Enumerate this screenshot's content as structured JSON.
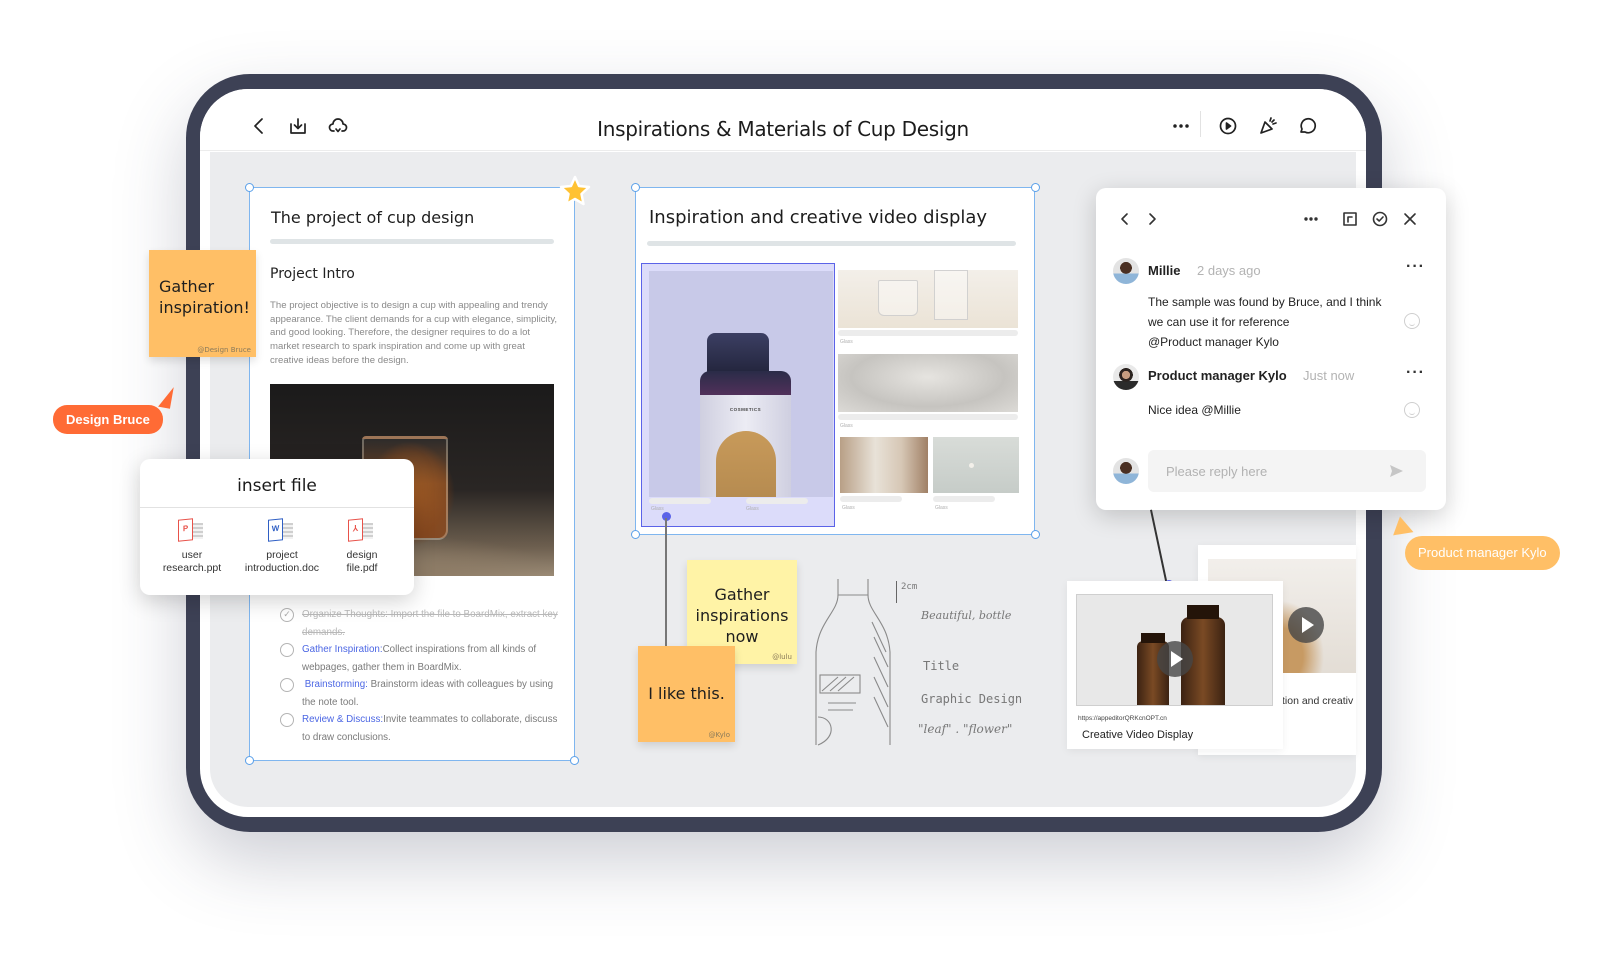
{
  "document": {
    "title": "Inspirations & Materials of Cup Design"
  },
  "toolbar": {
    "left_icons": [
      "back-icon",
      "download-icon",
      "cloud-icon"
    ],
    "right_icons": [
      "more-icon",
      "play-icon",
      "celebrate-icon",
      "comment-icon"
    ]
  },
  "frame_project": {
    "title": "The project of cup design",
    "intro_heading": "Project Intro",
    "intro_body": "The project objective is to design a cup with appealing and trendy appearance. The client demands for a cup with elegance, simplicity, and good looking. Therefore, the designer requires to do a lot market research to spark inspiration and come up with great creative ideas before the design.",
    "tasks": [
      {
        "done": true,
        "highlight": "",
        "text": "Organize Thoughts: Import the file to BoardMix, extract key demands."
      },
      {
        "done": false,
        "highlight": "Gather Inspiration:",
        "text": "Collect inspirations from all kinds of webpages, gather them in BoardMix."
      },
      {
        "done": false,
        "highlight": "Brainstorming:",
        "text": " Brainstorm ideas with colleagues by using the note tool."
      },
      {
        "done": false,
        "highlight": "Review & Discuss:",
        "text": "Invite teammates to collaborate, discuss to draw conclusions."
      }
    ]
  },
  "frame_inspiration": {
    "title": "Inspiration and creative video display",
    "product_label": "COSMETICS",
    "captions": [
      "Glass",
      "Glass",
      "Glass",
      "Glass",
      "Glass",
      "Glass"
    ]
  },
  "insert_file": {
    "title": "insert file",
    "files": [
      {
        "name_line1": "user",
        "name_line2": "research.ppt",
        "icon": "ppt-file-icon",
        "letter": "P",
        "color": "#e8524a"
      },
      {
        "name_line1": "project",
        "name_line2": "introduction.doc",
        "icon": "word-file-icon",
        "letter": "W",
        "color": "#2f5fc4"
      },
      {
        "name_line1": "design",
        "name_line2": "file.pdf",
        "icon": "pdf-file-icon",
        "letter": "⅄",
        "color": "#e8524a"
      }
    ]
  },
  "stickies": {
    "gather_inspiration": {
      "text": "Gather inspiration!",
      "author": "@Design Bruce",
      "color": "#ffbf66"
    },
    "gather_now": {
      "text": "Gather inspirations now",
      "author": "@lulu",
      "color": "#fff3a6"
    },
    "like_this": {
      "text": "I like this.",
      "author": "@Kylo",
      "color": "#ffbf66"
    }
  },
  "cursors": {
    "design_bruce": {
      "label": "Design Bruce",
      "color": "#ff6b35"
    },
    "pm_kylo": {
      "label": "Product manager Kylo",
      "color": "#ffbf66"
    }
  },
  "comments": {
    "thread": [
      {
        "author": "Millie",
        "time": "2 days ago",
        "line1": " The sample was found by Bruce, and I think",
        "line2": "we can use it for reference",
        "line3": "@Product manager Kylo"
      },
      {
        "author": "Product manager Kylo",
        "time": "Just now",
        "line1": "Nice idea @Millie"
      }
    ],
    "reply_placeholder": "Please reply here",
    "icons": [
      "prev-icon",
      "next-icon",
      "more-icon",
      "export-icon",
      "resolve-icon",
      "close-icon"
    ]
  },
  "sketch": {
    "dimension": "2cm",
    "notes": [
      "Beautiful, bottle",
      "Title",
      "Graphic Design",
      "\"leaf\" . \"flower\""
    ]
  },
  "video_cards": {
    "main": {
      "url": "https://appeditorQRKcnOPT.cn",
      "title": "Creative Video Display"
    },
    "back": {
      "title_fragment": "tion and creativ"
    }
  },
  "colors": {
    "device_frame": "#3d4155",
    "canvas": "#ebecee",
    "selection": "#5b63e8",
    "frame_border": "#7fb6ef",
    "link_blue": "#4b66e4",
    "star": "#ffc233"
  }
}
